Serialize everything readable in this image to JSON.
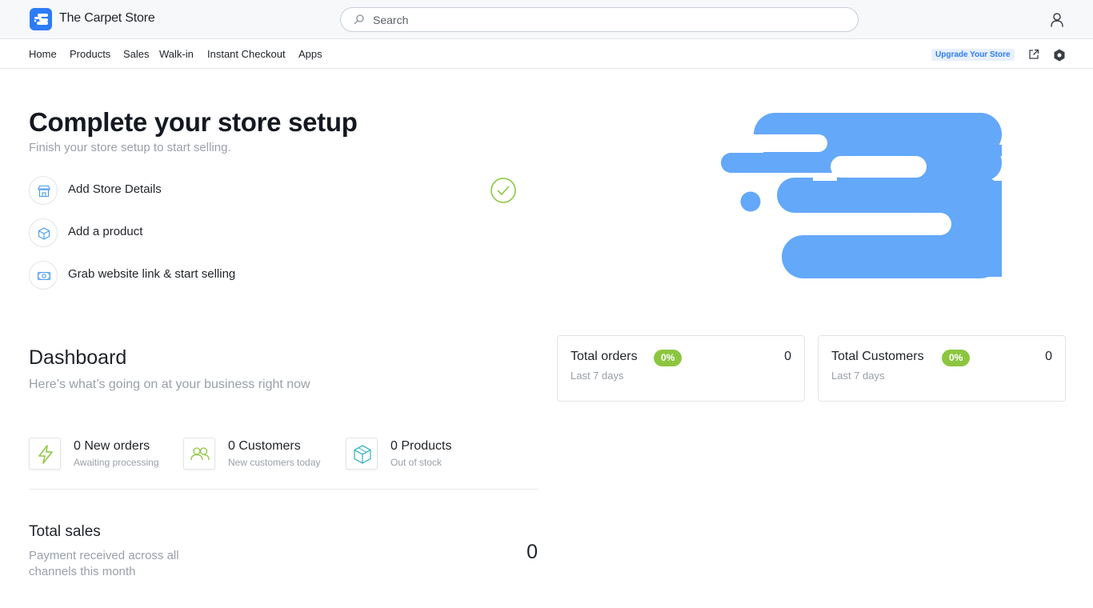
{
  "header": {
    "store_name": "The Carpet Store",
    "search_placeholder": "Search"
  },
  "nav": {
    "items": [
      "Home",
      "Products",
      "Sales",
      "Walk-in",
      "Instant Checkout",
      "Apps"
    ],
    "upgrade_label": "Upgrade Your Store"
  },
  "setup": {
    "title": "Complete your store setup",
    "subtitle": "Finish your store setup to start selling.",
    "steps": [
      {
        "label": "Add Store Details",
        "icon": "store-icon",
        "completed": true
      },
      {
        "label": "Add a product",
        "icon": "box-icon",
        "completed": false
      },
      {
        "label": "Grab website link & start selling",
        "icon": "cash-icon",
        "completed": false
      }
    ]
  },
  "dashboard": {
    "title": "Dashboard",
    "subtitle": "Here’s what’s going on at your business right now",
    "cards": [
      {
        "title": "Total orders",
        "badge": "0%",
        "value": "0",
        "period": "Last 7 days"
      },
      {
        "title": "Total Customers",
        "badge": "0%",
        "value": "0",
        "period": "Last 7 days"
      }
    ],
    "stats": [
      {
        "title": "0 New orders",
        "sub": "Awaiting processing",
        "icon": "lightning-icon"
      },
      {
        "title": "0 Customers",
        "sub": "New customers today",
        "icon": "users-icon"
      },
      {
        "title": "0 Products",
        "sub": "Out of stock",
        "icon": "cube-icon"
      }
    ],
    "sales": {
      "title": "Total sales",
      "subtitle": "Payment received across all channels this month",
      "value": "0"
    }
  },
  "colors": {
    "brand_blue": "#2d7cf6",
    "graphic_blue": "#64a8fa",
    "success_green": "#8cc63f"
  }
}
